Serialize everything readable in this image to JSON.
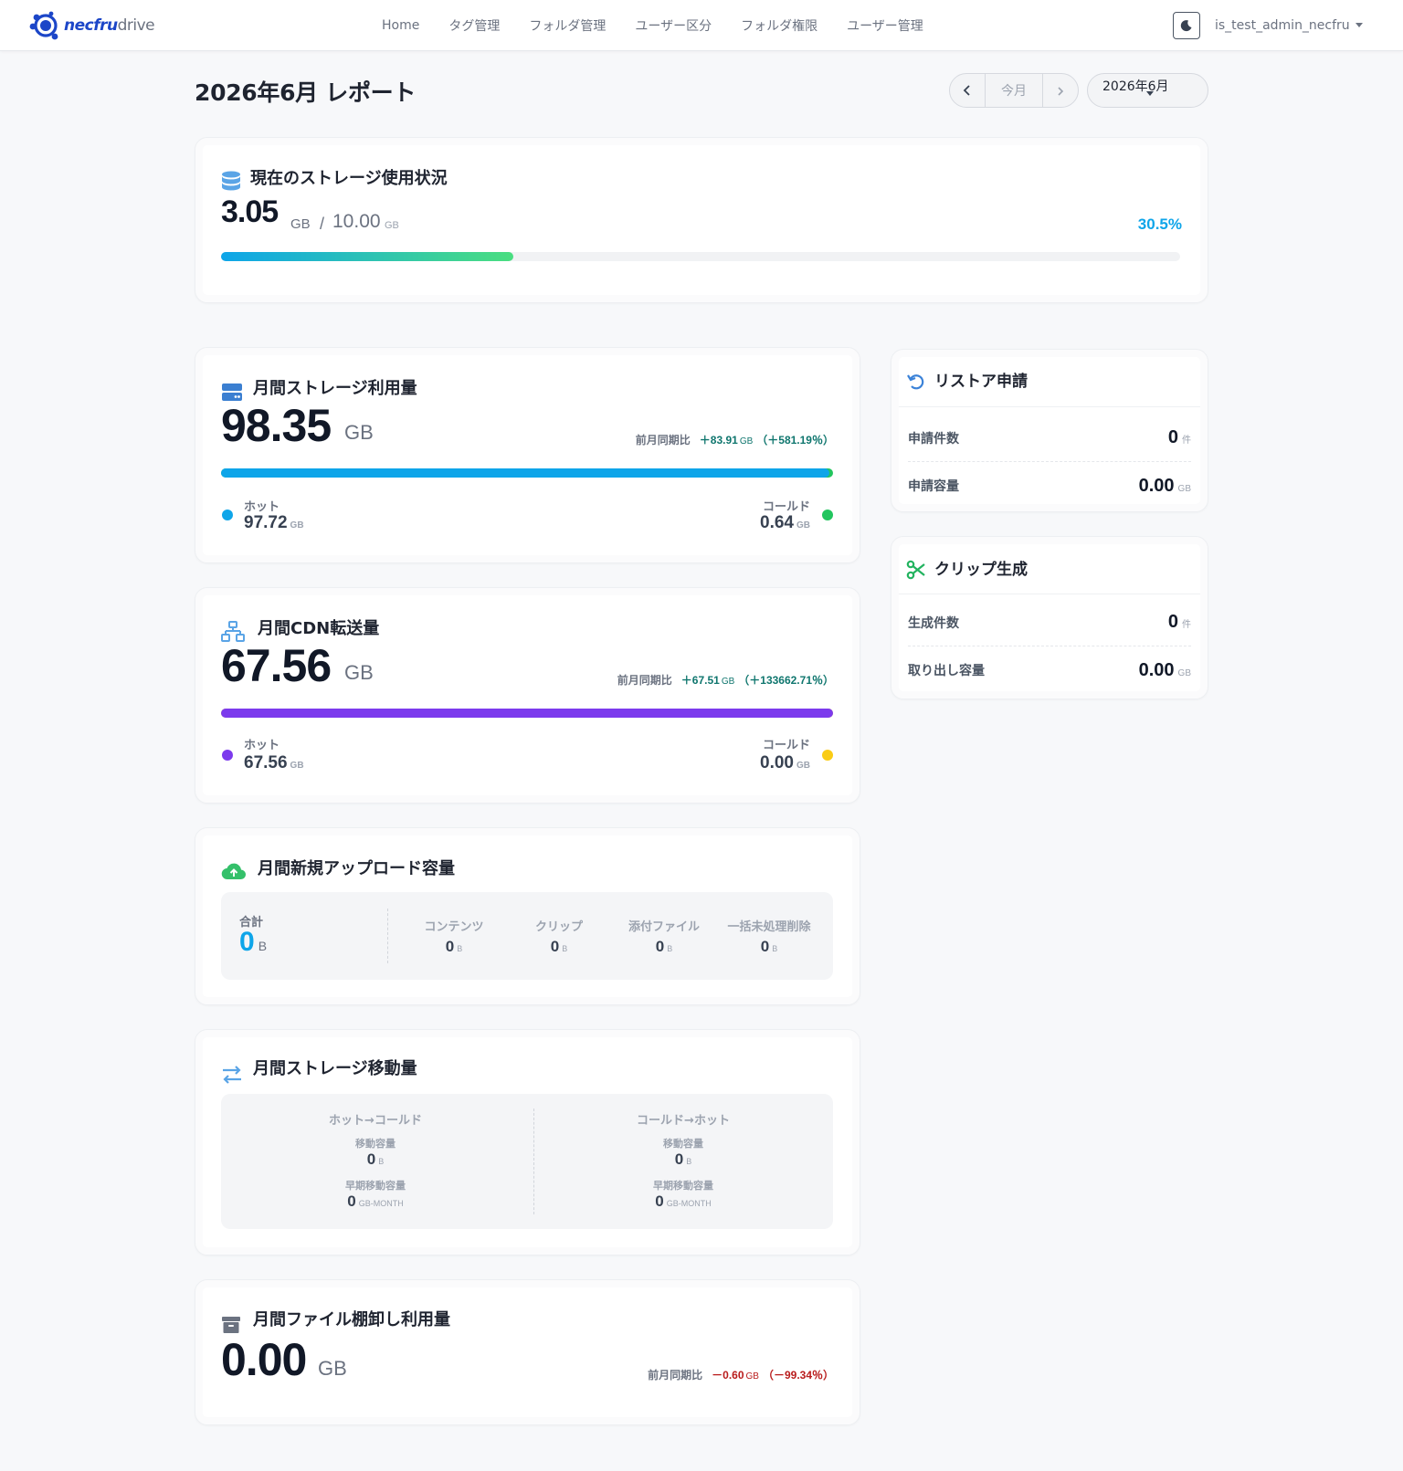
{
  "nav": {
    "brand_main": "necfru",
    "brand_sub": "drive",
    "links": [
      "Home",
      "タグ管理",
      "フォルダ管理",
      "ユーザー区分",
      "フォルダ権限",
      "ユーザー管理"
    ],
    "user": "is_test_admin_necfru"
  },
  "header": {
    "title": "2026年6月 レポート",
    "current_month_label": "今月",
    "month_select_value": "2026年6月"
  },
  "storage_status": {
    "title": "現在のストレージ使用状況",
    "used": "3.05",
    "used_unit": "GB",
    "separator": "/",
    "total": "10.00",
    "total_unit": "GB",
    "percent_label": "30.5%",
    "percent": 30.5
  },
  "monthly_storage": {
    "title": "月間ストレージ利用量",
    "value": "98.35",
    "unit": "GB",
    "compare_label": "前月同期比",
    "compare_diff": "＋83.91",
    "compare_diff_unit": "GB",
    "compare_pct": "（＋581.19％）",
    "hot_fraction": 0.9935,
    "hot_label": "ホット",
    "hot_value": "97.72",
    "hot_unit": "GB",
    "cold_label": "コールド",
    "cold_value": "0.64",
    "cold_unit": "GB"
  },
  "monthly_cdn": {
    "title": "月間CDN転送量",
    "value": "67.56",
    "unit": "GB",
    "compare_label": "前月同期比",
    "compare_diff": "＋67.51",
    "compare_diff_unit": "GB",
    "compare_pct": "（＋133662.71％）",
    "hot_fraction": 1.0,
    "hot_label": "ホット",
    "hot_value": "67.56",
    "hot_unit": "GB",
    "cold_label": "コールド",
    "cold_value": "0.00",
    "cold_unit": "GB"
  },
  "monthly_upload": {
    "title": "月間新規アップロード容量",
    "total_label": "合計",
    "total_value": "0",
    "total_unit": "B",
    "items": [
      {
        "label": "コンテンツ",
        "value": "0",
        "unit": "B"
      },
      {
        "label": "クリップ",
        "value": "0",
        "unit": "B"
      },
      {
        "label": "添付ファイル",
        "value": "0",
        "unit": "B"
      },
      {
        "label": "一括未処理削除",
        "value": "0",
        "unit": "B"
      }
    ]
  },
  "monthly_move": {
    "title": "月間ストレージ移動量",
    "groups": [
      {
        "label": "ホット→コールド",
        "move_label": "移動容量",
        "move_value": "0",
        "move_unit": "B",
        "early_label": "早期移動容量",
        "early_value": "0",
        "early_unit": "GB-MONTH"
      },
      {
        "label": "コールド→ホット",
        "move_label": "移動容量",
        "move_value": "0",
        "move_unit": "B",
        "early_label": "早期移動容量",
        "early_value": "0",
        "early_unit": "GB-MONTH"
      }
    ]
  },
  "monthly_archive": {
    "title": "月間ファイル棚卸し利用量",
    "value": "0.00",
    "unit": "GB",
    "compare_label": "前月同期比",
    "compare_diff": "－0.60",
    "compare_diff_unit": "GB",
    "compare_pct": "（－99.34％）"
  },
  "restore": {
    "title": "リストア申請",
    "rows": [
      {
        "label": "申請件数",
        "value": "0",
        "unit": "件"
      },
      {
        "label": "申請容量",
        "value": "0.00",
        "unit": "GB"
      }
    ]
  },
  "clip": {
    "title": "クリップ生成",
    "rows": [
      {
        "label": "生成件数",
        "value": "0",
        "unit": "件"
      },
      {
        "label": "取り出し容量",
        "value": "0.00",
        "unit": "GB"
      }
    ]
  },
  "colors": {
    "brand": "#1c46c8",
    "storage_grad_start": "#0ea5e9",
    "storage_grad_end": "#4ade80",
    "hot_storage": "#0ea5e9",
    "cold_storage": "#22c55e",
    "hot_cdn": "#7c3aed",
    "cold_cdn": "#facc15",
    "percent_text": "#0ea5e9",
    "positive": "#0f766e",
    "negative": "#b91c1c"
  }
}
